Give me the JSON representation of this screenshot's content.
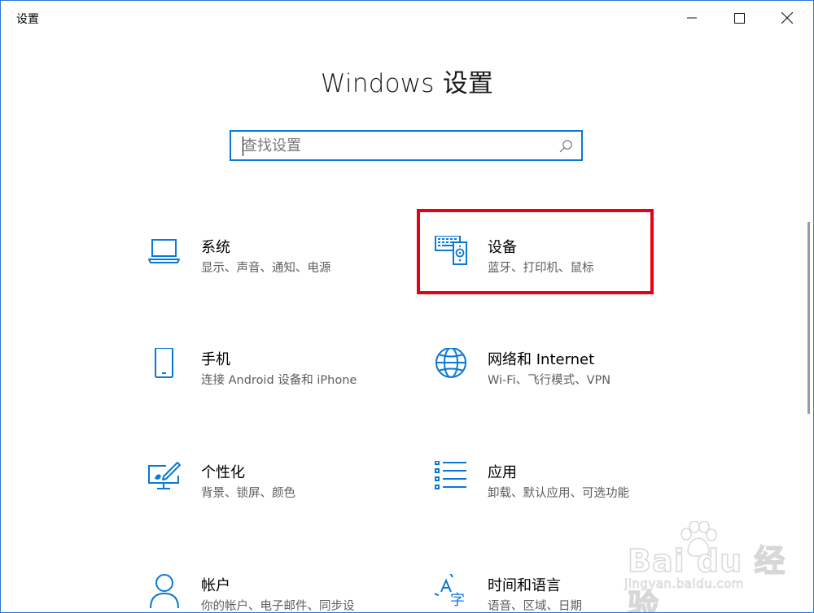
{
  "window": {
    "title": "设置",
    "controls": {
      "minimize": "minimize-icon",
      "maximize": "maximize-icon",
      "close": "close-icon"
    }
  },
  "page": {
    "title": "Windows 设置"
  },
  "search": {
    "placeholder": "查找设置",
    "value": "",
    "icon": "search-icon"
  },
  "tiles": [
    {
      "name": "系统",
      "desc": "显示、声音、通知、电源",
      "icon": "laptop-icon"
    },
    {
      "name": "设备",
      "desc": "蓝牙、打印机、鼠标",
      "icon": "devices-icon"
    },
    {
      "name": "手机",
      "desc": "连接 Android 设备和 iPhone",
      "icon": "phone-icon"
    },
    {
      "name": "网络和 Internet",
      "desc": "Wi-Fi、飞行模式、VPN",
      "icon": "globe-icon"
    },
    {
      "name": "个性化",
      "desc": "背景、锁屏、颜色",
      "icon": "personalization-icon"
    },
    {
      "name": "应用",
      "desc": "卸载、默认应用、可选功能",
      "icon": "apps-list-icon"
    },
    {
      "name": "帐户",
      "desc": "你的帐户、电子邮件、同步设",
      "icon": "person-icon"
    },
    {
      "name": "时间和语言",
      "desc": "语音、区域、日期",
      "icon": "time-language-icon"
    }
  ],
  "highlighted_tile": "设备",
  "watermark": {
    "brand": "Bai du 经验",
    "site": "jingyan.baidu.com"
  },
  "colors": {
    "accent": "#0a78d7",
    "highlight": "#e60012",
    "window_border": "#2b79d6"
  }
}
